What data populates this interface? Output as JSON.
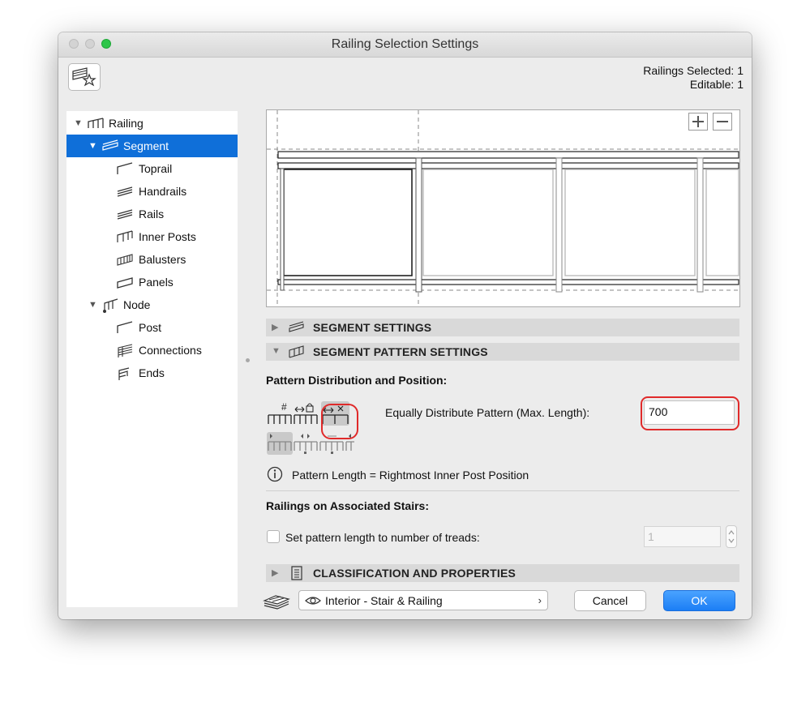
{
  "window": {
    "title": "Railing Selection Settings"
  },
  "favorites_button": {
    "icon": "favorites-star-icon"
  },
  "selection_info": {
    "selected": "Railings Selected: 1",
    "editable": "Editable: 1"
  },
  "tree": {
    "items": [
      {
        "label": "Railing",
        "icon": "railing-icon",
        "level": 0,
        "expanded": true
      },
      {
        "label": "Segment",
        "icon": "segment-icon",
        "level": 1,
        "expanded": true,
        "selected": true
      },
      {
        "label": "Toprail",
        "icon": "toprail-icon",
        "level": 2
      },
      {
        "label": "Handrails",
        "icon": "handrails-icon",
        "level": 2
      },
      {
        "label": "Rails",
        "icon": "rails-icon",
        "level": 2
      },
      {
        "label": "Inner Posts",
        "icon": "inner-posts-icon",
        "level": 2
      },
      {
        "label": "Balusters",
        "icon": "balusters-icon",
        "level": 2
      },
      {
        "label": "Panels",
        "icon": "panels-icon",
        "level": 2
      },
      {
        "label": "Node",
        "icon": "node-icon",
        "level": 1,
        "expanded": true
      },
      {
        "label": "Post",
        "icon": "post-icon",
        "level": 2
      },
      {
        "label": "Connections",
        "icon": "connections-icon",
        "level": 2
      },
      {
        "label": "Ends",
        "icon": "ends-icon",
        "level": 2
      }
    ]
  },
  "preview": {
    "zoom_in": "+",
    "zoom_out": "−"
  },
  "sections": {
    "segment_settings": "SEGMENT SETTINGS",
    "segment_pattern_settings": "SEGMENT PATTERN SETTINGS",
    "classification": "CLASSIFICATION AND PROPERTIES"
  },
  "pattern": {
    "heading": "Pattern Distribution and Position:",
    "distribute_label": "Equally Distribute Pattern (Max. Length):",
    "max_length_value": "700",
    "info_text": "Pattern Length = Rightmost Inner Post Position",
    "mode_icons": [
      "number-of-patterns-icon",
      "locked-length-icon",
      "equally-distribute-icon"
    ],
    "position_icons": [
      "align-left-icon",
      "align-center-icon",
      "align-spread-icon",
      "align-right-icon"
    ]
  },
  "stairs": {
    "heading": "Railings on Associated Stairs:",
    "checkbox_label": "Set pattern length to number of treads:",
    "checked": false,
    "treads_value": "1"
  },
  "footer": {
    "favorites_label": "Interior - Stair & Railing",
    "cancel_label": "Cancel",
    "ok_label": "OK"
  },
  "colors": {
    "selection": "#0f6fd9",
    "ok_button": "#1b7ef5",
    "highlight_ring": "#e02a2a"
  }
}
